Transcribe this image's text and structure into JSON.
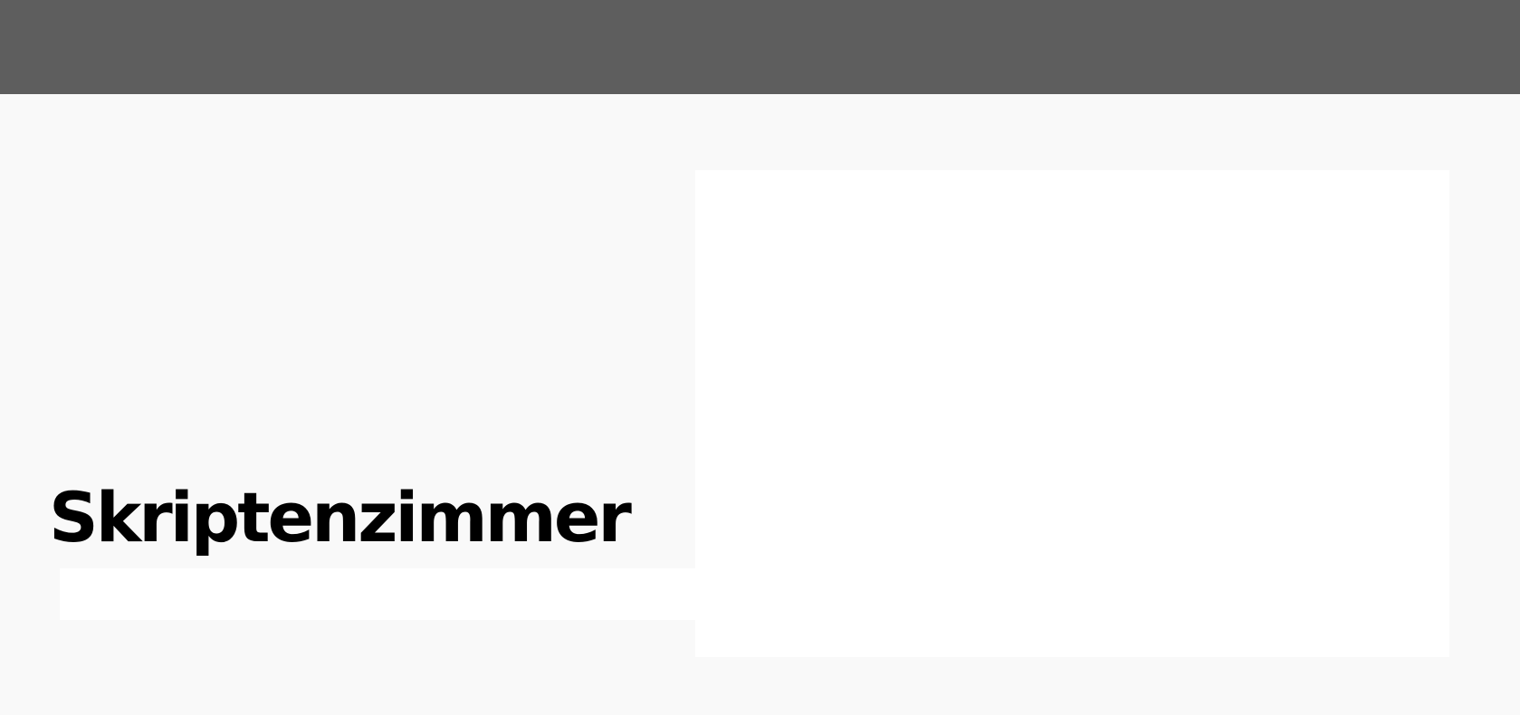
{
  "hero": {
    "title": "Skriptenzimmer"
  },
  "colors": {
    "topbar": "#5e5e5e",
    "background": "#f9f9f9",
    "panel": "#ffffff",
    "title_text": "#000000"
  }
}
